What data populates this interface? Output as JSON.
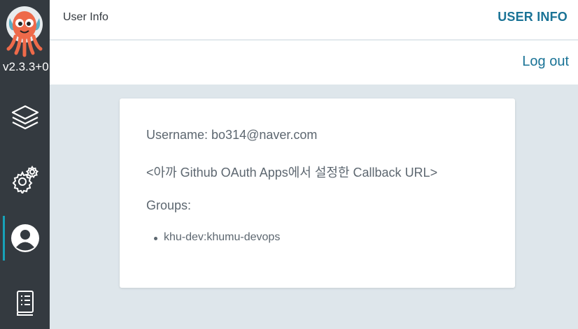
{
  "app": {
    "version": "v2.3.3+0",
    "colors": {
      "accent": "#1a7396",
      "sidebar": "#343a40",
      "active_indicator": "#17a2b8"
    }
  },
  "sidebar": {
    "items": [
      {
        "id": "applications",
        "icon": "layers-icon"
      },
      {
        "id": "settings",
        "icon": "gears-icon"
      },
      {
        "id": "user-info",
        "icon": "user-circle-icon",
        "active": true
      },
      {
        "id": "docs",
        "icon": "book-icon"
      }
    ]
  },
  "header": {
    "title": "User Info",
    "breadcrumb": "USER INFO"
  },
  "toolbar": {
    "logout_label": "Log out"
  },
  "user_info": {
    "username_line": "Username: bo314@naver.com",
    "issuer_line": "<아까 Github OAuth Apps에서 설정한 Callback URL>",
    "groups_label": "Groups:",
    "groups": [
      "khu-dev:khumu-devops"
    ]
  }
}
